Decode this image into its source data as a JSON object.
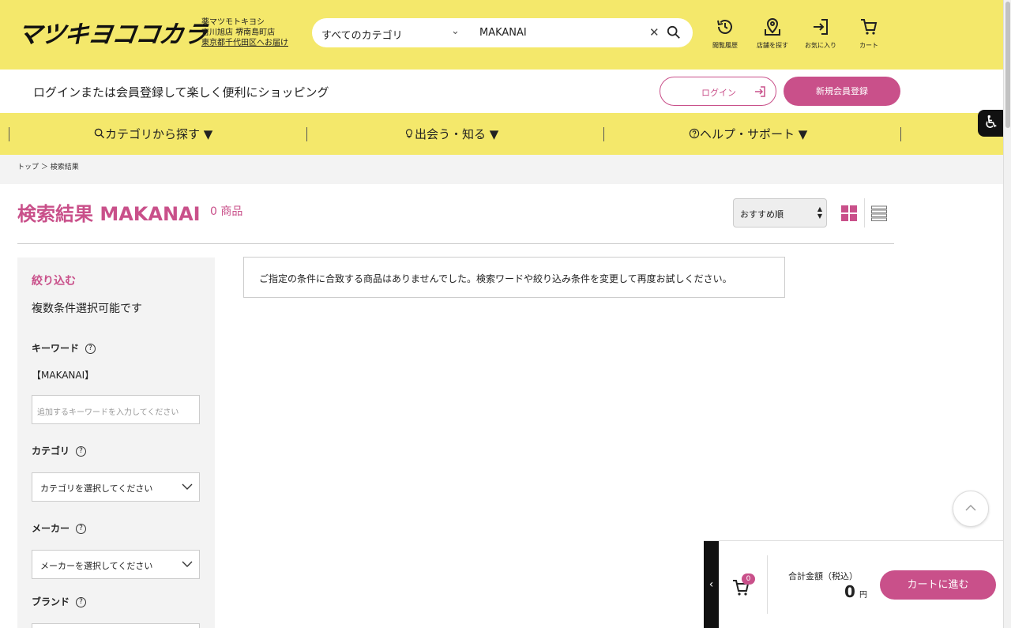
{
  "header": {
    "logo": "マツキヨココカラ",
    "store_brand": "薬マツモトキヨシ",
    "store_name": "吉川旭店 堺南島町店",
    "store_delivery": "東京都千代田区へお届け",
    "search": {
      "category": "すべてのカテゴリ",
      "value": "MAKANAI"
    },
    "icons": [
      {
        "name": "history-icon",
        "label": "閲覧履歴"
      },
      {
        "name": "store-locator-icon",
        "label": "店舗を探す"
      },
      {
        "name": "favorites-icon",
        "label": "お気に入り"
      },
      {
        "name": "cart-icon",
        "label": "カート"
      }
    ]
  },
  "loginbar": {
    "message": "ログインまたは会員登録して楽しく便利にショッピング",
    "login_label": "ログイン",
    "register_label": "新規会員登録"
  },
  "nav": {
    "items": [
      {
        "icon": "search-icon",
        "label": "カテゴリから探す ▼"
      },
      {
        "icon": "lightbulb-icon",
        "label": "出会う・知る ▼"
      },
      {
        "icon": "help-circle-icon",
        "label": "ヘルプ・サポート ▼"
      }
    ]
  },
  "breadcrumb": {
    "home": "トップ",
    "separator": "＞",
    "current": "検索結果"
  },
  "results": {
    "title": "検索結果 MAKANAI",
    "count": "0 商品",
    "sort": "おすすめ順",
    "notice": "ご指定の条件に合致する商品はありませんでした。検索ワードや絞り込み条件を変更して再度お試しください。"
  },
  "sidebar": {
    "heading": "絞り込む",
    "subheading": "複数条件選択可能です",
    "keyword_label": "キーワード",
    "keyword_value": "【MAKANAI】",
    "keyword_placeholder": "追加するキーワードを入力してください",
    "category_label": "カテゴリ",
    "category_placeholder": "カテゴリを選択してください",
    "maker_label": "メーカー",
    "maker_placeholder": "メーカーを選択してください",
    "brand_label": "ブランド",
    "help_glyph": "?"
  },
  "cart": {
    "tab_glyph": "‹",
    "badge": "0",
    "total_label": "合計金額（税込）",
    "amount": "0",
    "currency": "円",
    "checkout_label": "カートに進む"
  },
  "colors": {
    "brand_yellow": "#f4e86b",
    "accent_pink": "#c9508a"
  }
}
